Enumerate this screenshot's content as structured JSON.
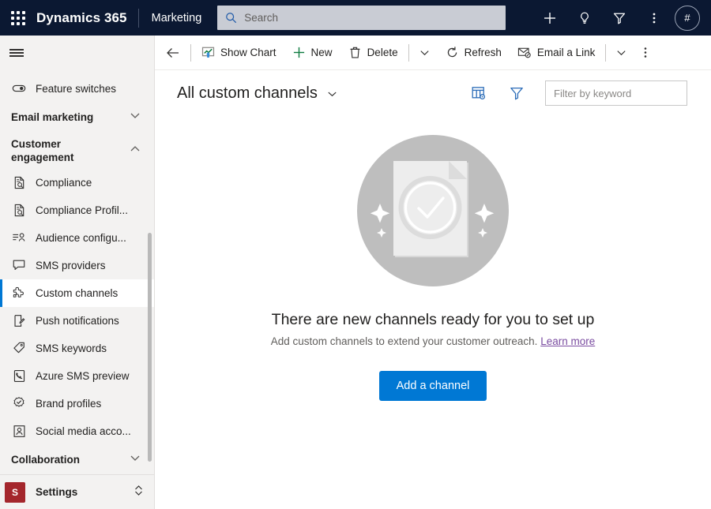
{
  "header": {
    "waffle_icon": "app-launcher-icon",
    "brand": "Dynamics 365",
    "app_name": "Marketing",
    "search": {
      "placeholder": "Search",
      "value": "",
      "icon": "search-icon"
    },
    "actions": [
      {
        "name": "quick-create",
        "icon": "plus-icon"
      },
      {
        "name": "insights",
        "icon": "lightbulb-icon"
      },
      {
        "name": "filter",
        "icon": "funnel-icon"
      },
      {
        "name": "more-options",
        "icon": "ellipsis-vertical-icon"
      }
    ],
    "avatar": {
      "initials": "#",
      "name": "user-avatar"
    }
  },
  "sidebar": {
    "menu_icon": "hamburger-icon",
    "items": [
      {
        "label": "Feature switches",
        "icon": "toggle-switch-icon",
        "type": "item",
        "selected": false
      },
      {
        "label": "Email marketing",
        "icon": "chevron-down-icon",
        "type": "group",
        "expanded": false
      },
      {
        "label": "Customer engagement",
        "icon": "chevron-up-icon",
        "type": "group",
        "expanded": true
      },
      {
        "label": "Compliance",
        "icon": "document-search-icon",
        "type": "item",
        "selected": false
      },
      {
        "label": "Compliance Profil...",
        "icon": "document-search-icon",
        "type": "item",
        "selected": false
      },
      {
        "label": "Audience configu...",
        "icon": "audience-icon",
        "type": "item",
        "selected": false
      },
      {
        "label": "SMS providers",
        "icon": "chat-bubble-icon",
        "type": "item",
        "selected": false
      },
      {
        "label": "Custom channels",
        "icon": "puzzle-piece-icon",
        "type": "item",
        "selected": true
      },
      {
        "label": "Push notifications",
        "icon": "push-notification-icon",
        "type": "item",
        "selected": false
      },
      {
        "label": "SMS keywords",
        "icon": "tag-icon",
        "type": "item",
        "selected": false
      },
      {
        "label": "Azure SMS preview",
        "icon": "azure-sms-icon",
        "type": "item",
        "selected": false
      },
      {
        "label": "Brand profiles",
        "icon": "verified-badge-icon",
        "type": "item",
        "selected": false
      },
      {
        "label": "Social media acco...",
        "icon": "social-account-icon",
        "type": "item",
        "selected": false
      },
      {
        "label": "Collaboration",
        "icon": "chevron-down-icon",
        "type": "group",
        "expanded": false
      }
    ],
    "area_switcher": {
      "badge": "S",
      "label": "Settings",
      "icon": "chevron-up-down-icon"
    }
  },
  "commandbar": {
    "back": {
      "name": "back-button",
      "icon": "arrow-left-icon"
    },
    "commands": [
      {
        "label": "Show Chart",
        "icon": "show-chart-icon"
      },
      {
        "label": "New",
        "icon": "plus-green-icon"
      },
      {
        "label": "Delete",
        "icon": "trash-icon"
      }
    ],
    "commands2": [
      {
        "label": "Refresh",
        "icon": "refresh-icon"
      },
      {
        "label": "Email a Link",
        "icon": "email-link-icon"
      }
    ],
    "chevron_icon": "chevron-down-icon",
    "overflow_icon": "ellipsis-vertical-icon"
  },
  "view": {
    "title": "All custom channels",
    "title_chevron_icon": "chevron-down-icon",
    "edit_columns_icon": "edit-columns-icon",
    "filter_icon": "funnel-icon",
    "keyword_filter": {
      "placeholder": "Filter by keyword",
      "value": ""
    }
  },
  "empty_state": {
    "illustration": "document-check-illustration",
    "title": "There are new channels ready for you to set up",
    "subtitle": "Add custom channels to extend your customer outreach.",
    "link": "Learn more",
    "button": "Add a channel"
  },
  "colors": {
    "header_bg": "#0b1832",
    "accent": "#0078d4",
    "sidebar_bg": "#f3f2f1",
    "settings_badge": "#a4262c",
    "link": "#7a4ca0",
    "new_icon_green": "#107c41"
  }
}
